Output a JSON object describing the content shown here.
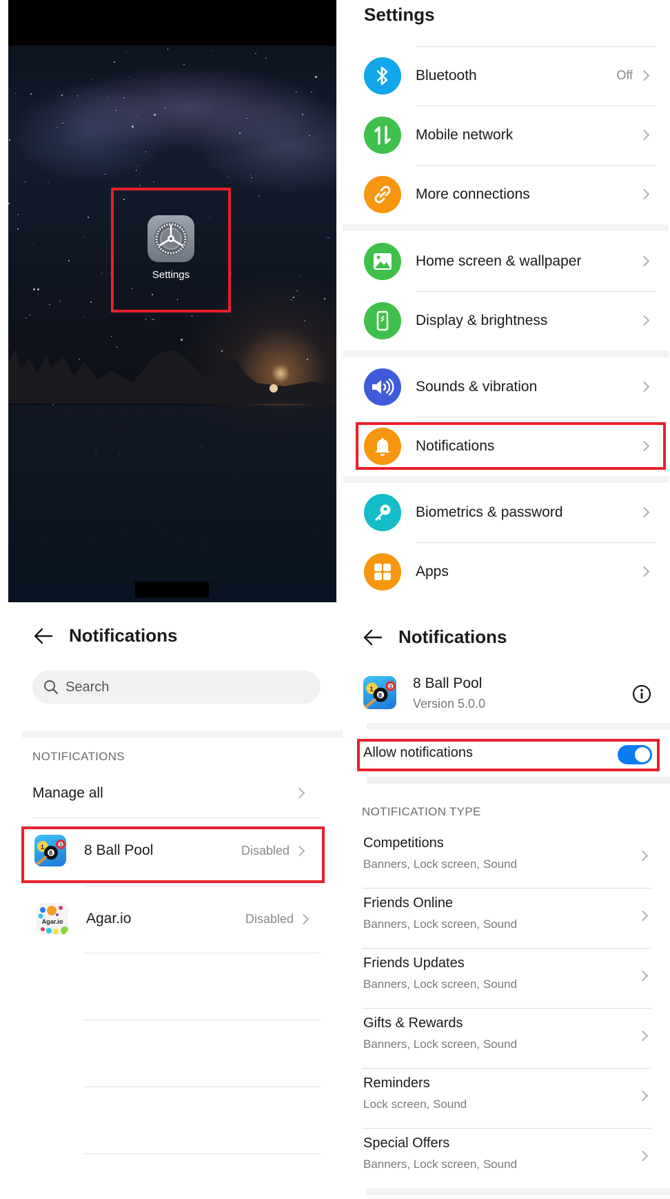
{
  "home_screen": {
    "app_label": "Settings",
    "app_icon": "gear-icon"
  },
  "settings": {
    "title": "Settings",
    "items": [
      {
        "label": "Bluetooth",
        "value": "Off",
        "icon": "bluetooth-icon",
        "color": "#12a6ea"
      },
      {
        "label": "Mobile network",
        "value": "",
        "icon": "mobile-data-icon",
        "color": "#3fc04a"
      },
      {
        "label": "More connections",
        "value": "",
        "icon": "link-icon",
        "color": "#f7960f"
      },
      {
        "label": "Home screen & wallpaper",
        "value": "",
        "icon": "image-icon",
        "color": "#3fc04a"
      },
      {
        "label": "Display & brightness",
        "value": "",
        "icon": "phone-display-icon",
        "color": "#3fc04a"
      },
      {
        "label": "Sounds & vibration",
        "value": "",
        "icon": "speaker-icon",
        "color": "#3f5bdc"
      },
      {
        "label": "Notifications",
        "value": "",
        "icon": "bell-icon",
        "color": "#f7960f"
      },
      {
        "label": "Biometrics & password",
        "value": "",
        "icon": "key-icon",
        "color": "#14bcc8"
      },
      {
        "label": "Apps",
        "value": "",
        "icon": "apps-grid-icon",
        "color": "#f7960f"
      }
    ]
  },
  "notifications_list": {
    "title": "Notifications",
    "search_placeholder": "Search",
    "section_header": "NOTIFICATIONS",
    "manage_all": "Manage all",
    "apps": [
      {
        "name": "8 Ball Pool",
        "status": "Disabled"
      },
      {
        "name": "Agar.io",
        "status": "Disabled"
      }
    ],
    "agar_icon_text": "Agar.io"
  },
  "app_notifications": {
    "title": "Notifications",
    "app_name": "8 Ball Pool",
    "app_version": "Version 5.0.0",
    "allow_label": "Allow notifications",
    "allow_enabled": true,
    "section_header": "NOTIFICATION TYPE",
    "types": [
      {
        "title": "Competitions",
        "sub": "Banners, Lock screen, Sound"
      },
      {
        "title": "Friends Online",
        "sub": "Banners, Lock screen, Sound"
      },
      {
        "title": "Friends Updates",
        "sub": "Banners, Lock screen, Sound"
      },
      {
        "title": "Gifts & Rewards",
        "sub": "Banners, Lock screen, Sound"
      },
      {
        "title": "Reminders",
        "sub": "Lock screen, Sound"
      },
      {
        "title": "Special Offers",
        "sub": "Banners, Lock screen, Sound"
      }
    ]
  },
  "colors": {
    "highlight": "#e8202a",
    "toggle_on": "#0a7cf5"
  }
}
